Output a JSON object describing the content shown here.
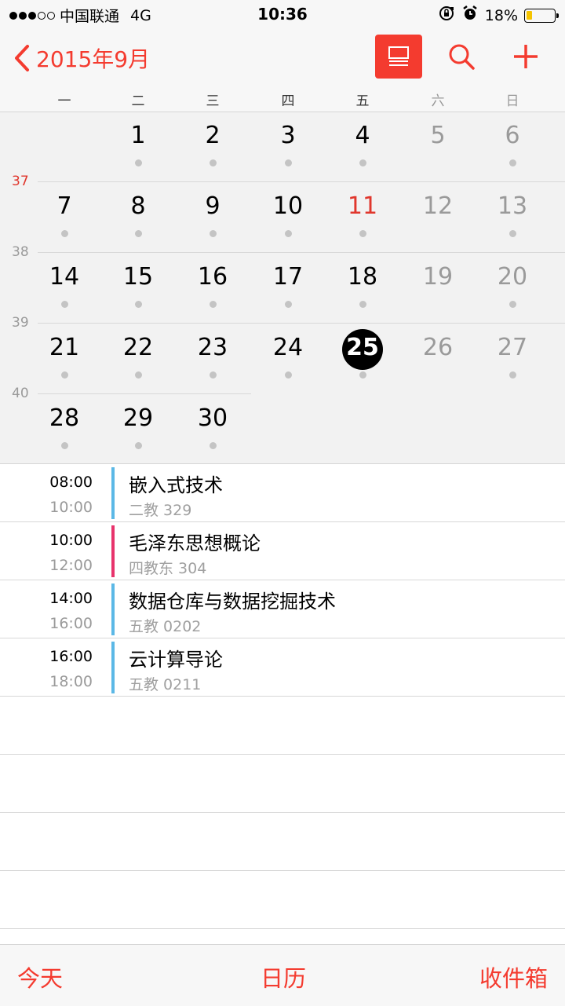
{
  "status_bar": {
    "carrier": "中国联通",
    "network": "4G",
    "time": "10:36",
    "battery": "18%",
    "battery_level": 0.18
  },
  "nav": {
    "back_label": "2015年9月",
    "accent_color": "#f43b2f"
  },
  "weekdays": [
    "一",
    "二",
    "三",
    "四",
    "五",
    "六",
    "日"
  ],
  "week_numbers": [
    "37",
    "38",
    "39",
    "40"
  ],
  "calendar": {
    "weeks": [
      [
        "",
        "1",
        "2",
        "3",
        "4",
        "5",
        "6"
      ],
      [
        "7",
        "8",
        "9",
        "10",
        "11",
        "12",
        "13"
      ],
      [
        "14",
        "15",
        "16",
        "17",
        "18",
        "19",
        "20"
      ],
      [
        "21",
        "22",
        "23",
        "24",
        "25",
        "26",
        "27"
      ],
      [
        "28",
        "29",
        "30",
        "",
        "",
        "",
        ""
      ]
    ],
    "today": "11",
    "selected": "25",
    "days_without_events": [
      "5",
      "12",
      "19",
      "26"
    ]
  },
  "events": [
    {
      "start": "08:00",
      "end": "10:00",
      "title": "嵌入式技术",
      "location": "二教 329",
      "color": "#5bb8e6"
    },
    {
      "start": "10:00",
      "end": "12:00",
      "title": "毛泽东思想概论",
      "location": "四教东 304",
      "color": "#e8336c"
    },
    {
      "start": "14:00",
      "end": "16:00",
      "title": "数据仓库与数据挖掘技术",
      "location": "五教 0202",
      "color": "#5bb8e6"
    },
    {
      "start": "16:00",
      "end": "18:00",
      "title": "云计算导论",
      "location": "五教 0211",
      "color": "#5bb8e6"
    }
  ],
  "tabbar": {
    "today": "今天",
    "calendars": "日历",
    "inbox": "收件箱"
  }
}
